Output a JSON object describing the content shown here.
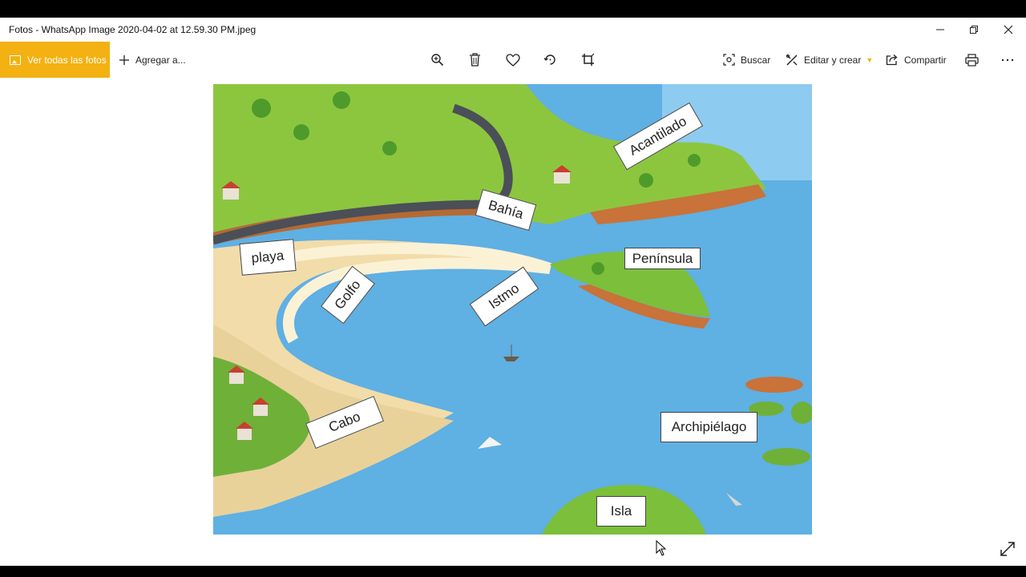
{
  "window": {
    "title": "Fotos - WhatsApp Image 2020-04-02 at 12.59.30 PM.jpeg",
    "controls": [
      "minimize-icon",
      "restore-icon",
      "close-icon"
    ]
  },
  "toolbar": {
    "all_photos_label": "Ver todas las fotos",
    "add_to_label": "Agregar a...",
    "search_label": "Buscar",
    "edit_create_label": "Editar y crear",
    "share_label": "Compartir",
    "accent_color": "#f3b112",
    "icons": [
      "zoom-in-icon",
      "delete-icon",
      "favorite-icon",
      "rotate-icon",
      "crop-icon",
      "print-icon",
      "more-icon"
    ]
  },
  "image": {
    "labels": {
      "acantilado": "Acantilado",
      "bahia": "Bahía",
      "playa": "playa",
      "peninsula": "Península",
      "golfo": "Golfo",
      "istmo": "Istmo",
      "cabo": "Cabo",
      "archipielago": "Archipiélago",
      "isla": "Isla"
    }
  }
}
